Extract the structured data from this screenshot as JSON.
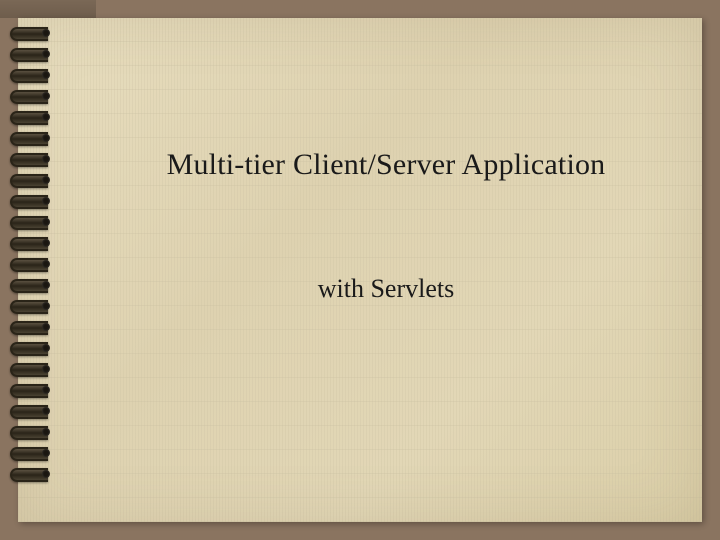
{
  "slide": {
    "title": "Multi-tier Client/Server Application",
    "subtitle": "with Servlets"
  },
  "theme": {
    "background": "#8a7460",
    "paper": "#e2d7b6",
    "text": "#1a1a1a"
  }
}
